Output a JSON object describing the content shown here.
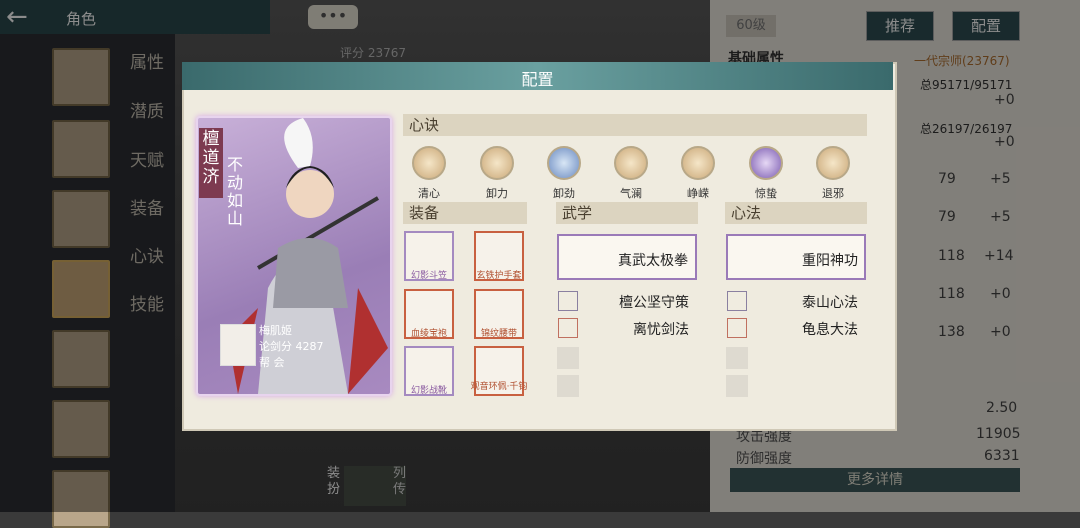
{
  "topbar": {
    "title": "角色",
    "chat": "•••"
  },
  "sidebar_tabs": [
    "属性",
    "潜质",
    "天赋",
    "装备",
    "心诀",
    "技能"
  ],
  "right_panel": {
    "level": "60级",
    "recommend_btn": "推荐",
    "config_btn": "配置",
    "rating_label": "评分 23767",
    "section_title": "基础属性",
    "rank_text": "一代宗师(23767)",
    "hp_total": "总95171/95171",
    "hp_plus": "+0",
    "mp_total": "总26197/26197",
    "mp_plus": "+0",
    "stat_rows": [
      {
        "val": "79",
        "plus": "+5"
      },
      {
        "val": "79",
        "plus": "+5"
      },
      {
        "val": "118",
        "plus": "+14"
      },
      {
        "val": "118",
        "plus": "+0"
      },
      {
        "val": "138",
        "plus": "+0"
      }
    ],
    "misc_val": "2.50",
    "atk_label": "攻击强度",
    "atk_val": "11905",
    "def_label": "防御强度",
    "def_val": "6331",
    "more_btn": "更多详情"
  },
  "bottom_tabs": {
    "outfit": "装扮",
    "bio": "列传"
  },
  "dialog": {
    "title": "配置",
    "hero": {
      "name": "檀道济",
      "motto": "不动如山",
      "owner": "梅肌姬",
      "sword_score": "论剑分 4287",
      "guild": "帮 会"
    },
    "xinjue_title": "心诀",
    "xinjue": [
      "清心",
      "卸力",
      "卸劲",
      "气澜",
      "峥嵘",
      "惊蛰",
      "退邪"
    ],
    "equip_title": "装备",
    "equipment": [
      "幻影斗笠",
      "玄铁护手套",
      "血绫宝袍",
      "锦纹腰带",
      "幻影战靴",
      "观音环佩·千钧"
    ],
    "wuxue_title": "武学",
    "wuxue_main": "真武太极拳",
    "wuxue_list": [
      "檀公坚守策",
      "离忧剑法"
    ],
    "xinfa_title": "心法",
    "xinfa_main": "重阳神功",
    "xinfa_list": [
      "泰山心法",
      "龟息大法"
    ]
  },
  "colors": {
    "header_teal": "#3a6a6c",
    "hero_purple": "#9a7eb6",
    "gold": "#d8b060"
  }
}
